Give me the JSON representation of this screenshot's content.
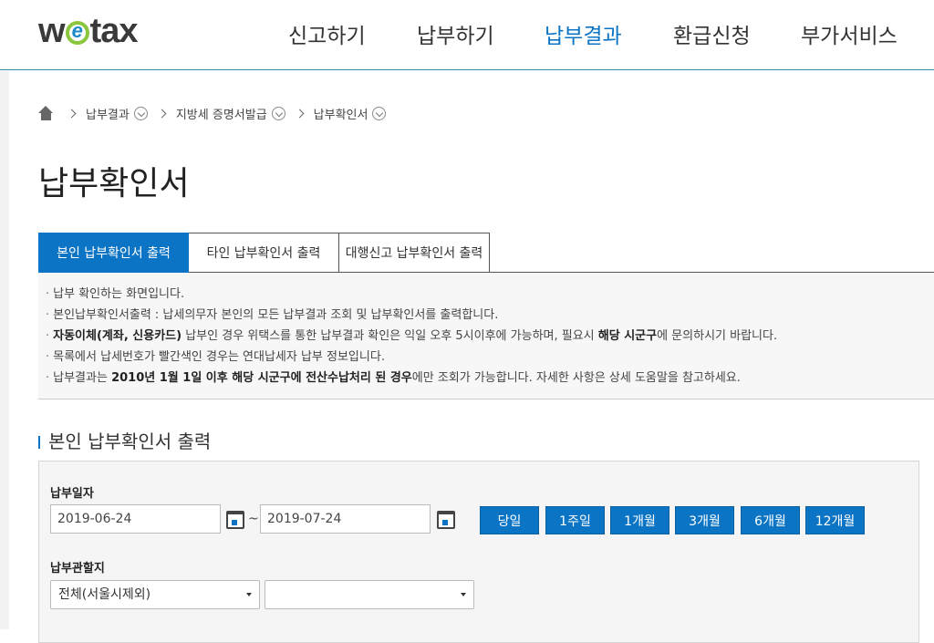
{
  "header": {
    "logo_text_left": "w",
    "logo_text_right": "tax",
    "nav": [
      {
        "label": "신고하기",
        "active": false
      },
      {
        "label": "납부하기",
        "active": false
      },
      {
        "label": "납부결과",
        "active": true
      },
      {
        "label": "환급신청",
        "active": false
      },
      {
        "label": "부가서비스",
        "active": false
      }
    ]
  },
  "breadcrumb": [
    "납부결과",
    "지방세 증명서발급",
    "납부확인서"
  ],
  "page_title": "납부확인서",
  "tabs": [
    "본인 납부확인서 출력",
    "타인 납부확인서 출력",
    "대행신고 납부확인서 출력"
  ],
  "notice": {
    "line1": "납부 확인하는 화면입니다.",
    "line2": "본인납부확인서출력 : 납세의무자 본인의 모든 납부결과 조회 및 납부확인서를 출력합니다.",
    "line3_bold1": "자동이체(계좌, 신용카드)",
    "line3_mid": " 납부인 경우 위택스를 통한 납부결과 확인은 익일 오후 5시이후에 가능하며, 필요시 ",
    "line3_bold2": "해당 시군구",
    "line3_end": "에 문의하시기 바랍니다.",
    "line4": "목록에서 납세번호가 빨간색인 경우는 연대납세자 납부 정보입니다.",
    "line5_start": "납부결과는 ",
    "line5_bold": "2010년 1월 1일 이후 해당 시군구에 전산수납처리 된 경우",
    "line5_end": "에만 조회가 가능합니다. 자세한 사항은 상세 도움말을 참고하세요."
  },
  "section_title": "본인 납부확인서 출력",
  "search": {
    "date_label": "납부일자",
    "date_from": "2019-06-24",
    "date_to": "2019-07-24",
    "tilde": "~",
    "period_buttons": [
      "당일",
      "1주일",
      "1개월",
      "3개월",
      "6개월",
      "12개월"
    ],
    "region_label": "납부관할지",
    "region_selected": "전체(서울시제외)",
    "subregion_selected": ""
  },
  "colors": {
    "accent": "#0b74c4",
    "logo_green": "#8cc63f"
  }
}
